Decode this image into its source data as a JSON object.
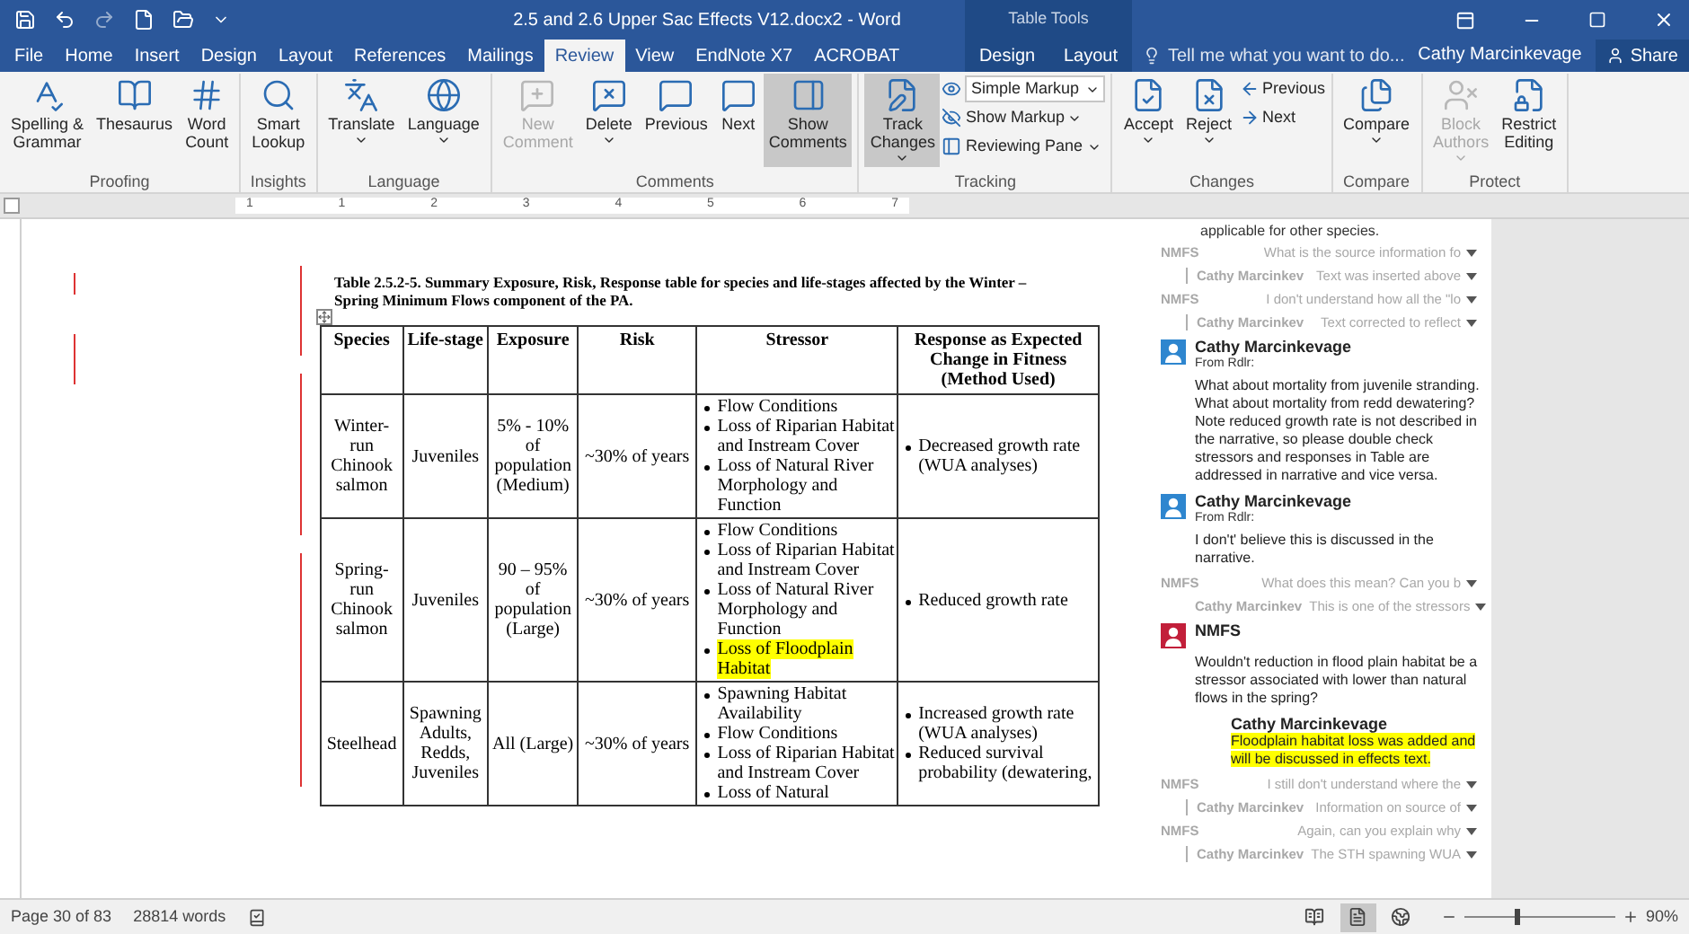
{
  "window": {
    "title": "2.5 and 2.6 Upper Sac Effects V12.docx2 - Word",
    "contextual_group": "Table Tools",
    "user": "Cathy Marcinkevage",
    "share": "Share"
  },
  "tabs": [
    {
      "label": "File",
      "selected": false,
      "kind": "main"
    },
    {
      "label": "Home",
      "selected": false,
      "kind": "main"
    },
    {
      "label": "Insert",
      "selected": false,
      "kind": "main"
    },
    {
      "label": "Design",
      "selected": false,
      "kind": "main"
    },
    {
      "label": "Layout",
      "selected": false,
      "kind": "main"
    },
    {
      "label": "References",
      "selected": false,
      "kind": "main"
    },
    {
      "label": "Mailings",
      "selected": false,
      "kind": "main"
    },
    {
      "label": "Review",
      "selected": true,
      "kind": "main"
    },
    {
      "label": "View",
      "selected": false,
      "kind": "main"
    },
    {
      "label": "EndNote X7",
      "selected": false,
      "kind": "main"
    },
    {
      "label": "ACROBAT",
      "selected": false,
      "kind": "main"
    },
    {
      "label": "Design",
      "selected": false,
      "kind": "contextual"
    },
    {
      "label": "Layout",
      "selected": false,
      "kind": "contextual"
    }
  ],
  "tell_me": {
    "placeholder": "Tell me what you want to do..."
  },
  "ribbon_groups": [
    {
      "label": "Proofing",
      "buttons": [
        {
          "kind": "large",
          "label": [
            "Spelling &",
            "Grammar"
          ],
          "disabled": false,
          "on": false,
          "dropdown": false
        },
        {
          "kind": "large",
          "label": [
            "Thesaurus"
          ],
          "disabled": false,
          "on": false,
          "dropdown": false
        },
        {
          "kind": "large",
          "label": [
            "Word",
            "Count"
          ],
          "disabled": false,
          "on": false,
          "dropdown": false
        }
      ]
    },
    {
      "label": "Insights",
      "buttons": [
        {
          "kind": "large",
          "label": [
            "Smart",
            "Lookup"
          ],
          "disabled": false,
          "on": false,
          "dropdown": false
        }
      ]
    },
    {
      "label": "Language",
      "buttons": [
        {
          "kind": "large",
          "label": [
            "Translate"
          ],
          "disabled": false,
          "on": false,
          "dropdown": true
        },
        {
          "kind": "large",
          "label": [
            "Language"
          ],
          "disabled": false,
          "on": false,
          "dropdown": true
        }
      ]
    },
    {
      "label": "Comments",
      "buttons": [
        {
          "kind": "large",
          "label": [
            "New",
            "Comment"
          ],
          "disabled": true,
          "on": false,
          "dropdown": false
        },
        {
          "kind": "large",
          "label": [
            "Delete"
          ],
          "disabled": false,
          "on": false,
          "dropdown": true
        },
        {
          "kind": "large",
          "label": [
            "Previous"
          ],
          "disabled": false,
          "on": false,
          "dropdown": false
        },
        {
          "kind": "large",
          "label": [
            "Next"
          ],
          "disabled": false,
          "on": false,
          "dropdown": false
        },
        {
          "kind": "large",
          "label": [
            "Show",
            "Comments"
          ],
          "disabled": false,
          "on": true,
          "dropdown": false
        }
      ]
    },
    {
      "label": "Tracking",
      "buttons": [
        {
          "kind": "large",
          "label": [
            "Track",
            "Changes"
          ],
          "disabled": false,
          "on": true,
          "dropdown": true
        },
        {
          "kind": "select",
          "label": [
            "Simple Markup"
          ],
          "disabled": false,
          "on": false,
          "dropdown": true
        },
        {
          "kind": "small",
          "label": [
            "Show Markup"
          ],
          "disabled": false,
          "on": false,
          "dropdown": true
        },
        {
          "kind": "small",
          "label": [
            "Reviewing Pane"
          ],
          "disabled": false,
          "on": false,
          "dropdown": true
        }
      ]
    },
    {
      "label": "Changes",
      "buttons": [
        {
          "kind": "large",
          "label": [
            "Accept"
          ],
          "disabled": false,
          "on": false,
          "dropdown": true
        },
        {
          "kind": "large",
          "label": [
            "Reject"
          ],
          "disabled": false,
          "on": false,
          "dropdown": true
        },
        {
          "kind": "small",
          "label": [
            "Previous"
          ],
          "disabled": false,
          "on": false,
          "dropdown": false
        },
        {
          "kind": "small",
          "label": [
            "Next"
          ],
          "disabled": false,
          "on": false,
          "dropdown": false
        }
      ]
    },
    {
      "label": "Compare",
      "buttons": [
        {
          "kind": "large",
          "label": [
            "Compare"
          ],
          "disabled": false,
          "on": false,
          "dropdown": true
        }
      ]
    },
    {
      "label": "Protect",
      "buttons": [
        {
          "kind": "large",
          "label": [
            "Block",
            "Authors"
          ],
          "disabled": true,
          "on": false,
          "dropdown": true
        },
        {
          "kind": "large",
          "label": [
            "Restrict",
            "Editing"
          ],
          "disabled": false,
          "on": false,
          "dropdown": false
        }
      ]
    }
  ],
  "ruler_labels": [
    "1",
    "1",
    "2",
    "3",
    "4",
    "5",
    "6",
    "7"
  ],
  "document": {
    "caption": "Table 2.5.2-5. Summary Exposure, Risk, Response table for species and life-stages affected by the Winter – Spring Minimum Flows component of the PA.",
    "table": {
      "columns": [
        "Species",
        "Life-stage",
        "Exposure",
        "Risk",
        "Stressor",
        "Response as Expected Change in Fitness (Method Used)"
      ],
      "rows": [
        {
          "species": "Winter-run Chinook salmon",
          "life_stage": "Juveniles",
          "exposure": "5% - 10% of population (Medium)",
          "risk": "~30% of years",
          "stressors": [
            {
              "text": "Flow Conditions",
              "highlighted": false
            },
            {
              "text": "Loss of Riparian Habitat and Instream Cover",
              "highlighted": false
            },
            {
              "text": "Loss of Natural River Morphology and Function",
              "highlighted": false
            }
          ],
          "responses": [
            "Decreased growth rate (WUA analyses)"
          ]
        },
        {
          "species": "Spring-run Chinook salmon",
          "life_stage": "Juveniles",
          "exposure": "90 – 95% of population (Large)",
          "risk": "~30% of years",
          "stressors": [
            {
              "text": "Flow Conditions",
              "highlighted": false
            },
            {
              "text": "Loss of Riparian Habitat and Instream Cover",
              "highlighted": false
            },
            {
              "text": "Loss of Natural River Morphology and Function",
              "highlighted": false
            },
            {
              "text": "Loss of Floodplain Habitat",
              "highlighted": true
            }
          ],
          "responses": [
            "Reduced growth rate"
          ]
        },
        {
          "species": "Steelhead",
          "life_stage": "Spawning Adults, Redds, Juveniles",
          "exposure": "All (Large)",
          "risk": "~30% of years",
          "stressors": [
            {
              "text": "Spawning Habitat Availability",
              "highlighted": false
            },
            {
              "text": "Flow Conditions",
              "highlighted": false
            },
            {
              "text": "Loss of Riparian Habitat and Instream Cover",
              "highlighted": false
            },
            {
              "text": "Loss of Natural",
              "highlighted": false
            }
          ],
          "responses": [
            "Increased growth rate (WUA analyses)",
            "Reduced survival probability (dewatering,"
          ]
        }
      ]
    }
  },
  "comments": [
    {
      "kind": "text",
      "text": "applicable for other species."
    },
    {
      "kind": "collapsed",
      "author": "NMFS",
      "preview": "What is the source information fo",
      "reply": false
    },
    {
      "kind": "collapsed",
      "author": "Cathy Marcinkev",
      "preview": "Text was inserted above",
      "reply": true
    },
    {
      "kind": "collapsed",
      "author": "NMFS",
      "preview": "I don't understand how all the \"lo",
      "reply": false
    },
    {
      "kind": "collapsed",
      "author": "Cathy Marcinkev",
      "preview": "Text corrected to reflect",
      "reply": true
    },
    {
      "kind": "expanded",
      "author": "Cathy Marcinkevage",
      "color": "#2e86cf",
      "from": "From Rdlr:",
      "body": [
        "What about mortality from juvenile stranding.",
        "What about mortality from redd dewatering? Note reduced growth rate is not described in the narrative, so please double check stressors and responses in Table are addressed in narrative and vice versa."
      ]
    },
    {
      "kind": "expanded",
      "author": "Cathy Marcinkevage",
      "color": "#2e86cf",
      "from": "From Rdlr:",
      "body": [
        "I don't' believe this is discussed in the narrative."
      ]
    },
    {
      "kind": "collapsed",
      "author": "NMFS",
      "preview": "What does this mean?  Can you b",
      "reply": false
    },
    {
      "kind": "collapsed",
      "author": "Cathy Marcinkev",
      "preview": "This is one of the stressors",
      "reply": true
    },
    {
      "kind": "expanded",
      "author": "NMFS",
      "color": "#c21f3a",
      "body": [
        "Wouldn't reduction in flood plain habitat be a stressor associated with lower than natural flows in the spring?"
      ],
      "reply": {
        "author": "Cathy Marcinkevage",
        "text": "Floodplain habitat loss was added and will be discussed in effects text.",
        "highlighted": true
      }
    },
    {
      "kind": "collapsed",
      "author": "NMFS",
      "preview": "I still don't understand where the",
      "reply": false
    },
    {
      "kind": "collapsed",
      "author": "Cathy Marcinkev",
      "preview": "Information on source of",
      "reply": true
    },
    {
      "kind": "collapsed",
      "author": "NMFS",
      "preview": "Again, can you explain why",
      "reply": false
    },
    {
      "kind": "collapsed",
      "author": "Cathy Marcinkev",
      "preview": "The STH spawning WUA",
      "reply": true
    }
  ],
  "status_bar": {
    "page": "Page 30 of 83",
    "words": "28814 words",
    "views": [
      {
        "selected": false
      },
      {
        "selected": true
      },
      {
        "selected": false
      }
    ],
    "zoom": {
      "level": 0.35,
      "reading": "90%"
    }
  }
}
